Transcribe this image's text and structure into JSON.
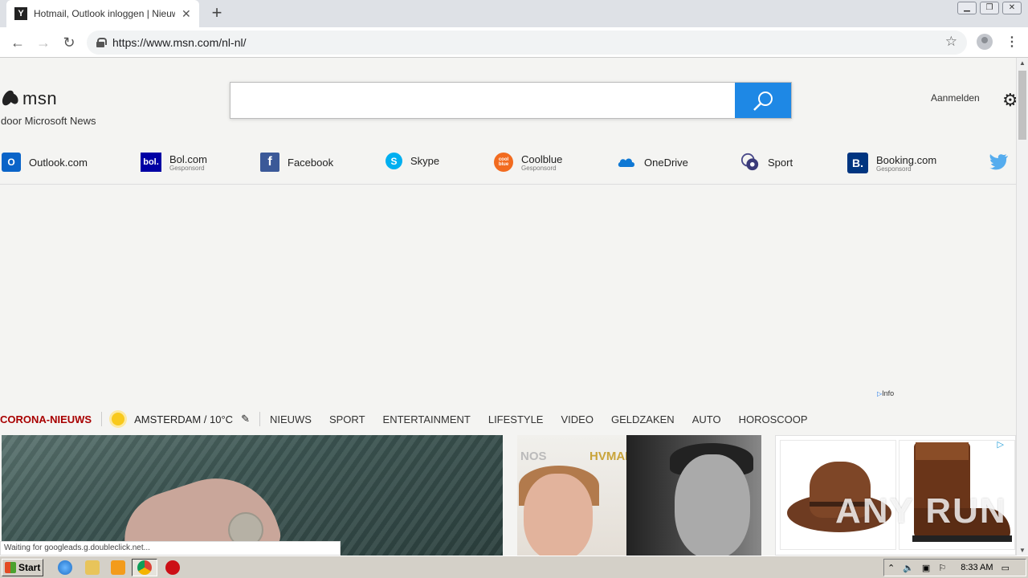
{
  "browser": {
    "tab_title": "Hotmail, Outlook inloggen | Nieuws, W",
    "tab_favicon": "Y",
    "url": "https://www.msn.com/nl-nl/",
    "status": "Waiting for googleads.g.doubleclick.net..."
  },
  "header": {
    "logo": "msn",
    "logo_sub": "door Microsoft News",
    "signin": "Aanmelden"
  },
  "quicklinks": [
    {
      "label": "Outlook.com",
      "sub": ""
    },
    {
      "label": "Bol.com",
      "sub": "Gesponsord",
      "icon_text": "bol."
    },
    {
      "label": "Facebook",
      "sub": ""
    },
    {
      "label": "Skype",
      "sub": ""
    },
    {
      "label": "Coolblue",
      "sub": "Gesponsord",
      "icon_text": "cool blue"
    },
    {
      "label": "OneDrive",
      "sub": ""
    },
    {
      "label": "Sport",
      "sub": ""
    },
    {
      "label": "Booking.com",
      "sub": "Gesponsord",
      "icon_text": "B."
    }
  ],
  "ad_info": "Info",
  "nav": {
    "corona": "CORONA-NIEUWS",
    "weather": "AMSTERDAM / 10°C",
    "items": [
      "NIEUWS",
      "SPORT",
      "ENTERTAINMENT",
      "LIFESTYLE",
      "VIDEO",
      "GELDZAKEN",
      "AUTO",
      "HOROSCOOP"
    ]
  },
  "card2": {
    "sign_left": "NOS",
    "sign_right": "HVMAN"
  },
  "watermark": "ANY RUN",
  "taskbar": {
    "start": "Start",
    "time": "8:33 AM"
  },
  "colors": {
    "accent": "#1e88e5",
    "corona": "#a80000"
  }
}
